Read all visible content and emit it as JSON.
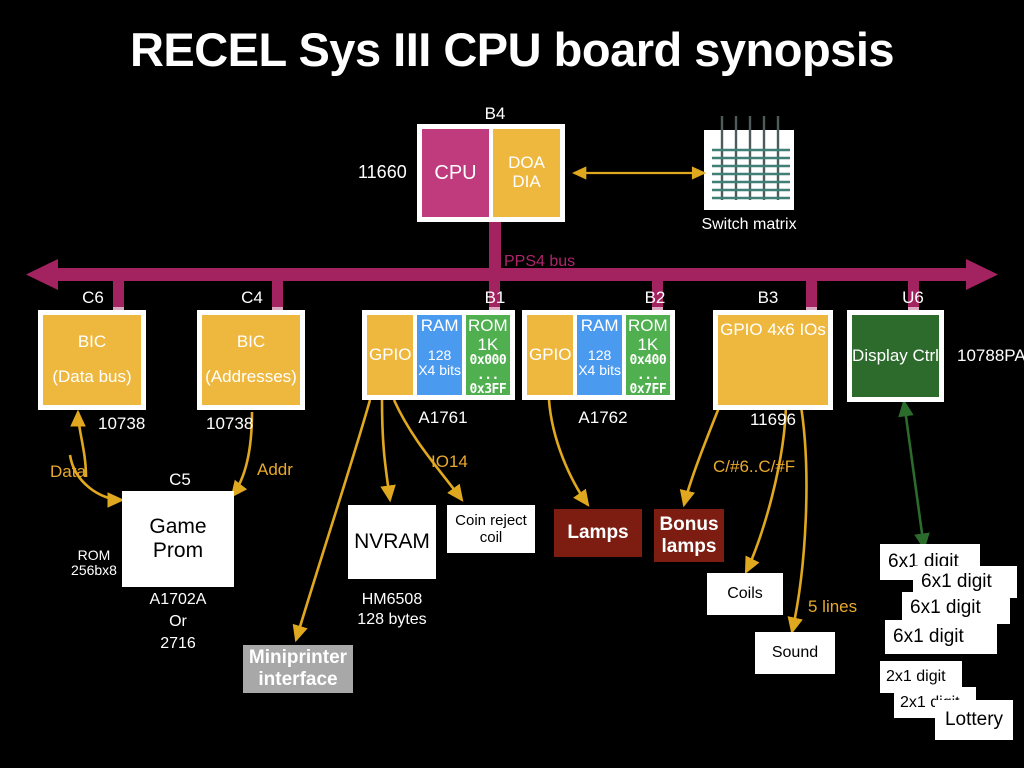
{
  "title": "RECEL Sys III CPU board synopsis",
  "bus": {
    "label": "PPS4 bus",
    "color": "#a32260"
  },
  "cpu_block": {
    "tag": "B4",
    "part": "11660",
    "cpu_label": "CPU",
    "doa_line1": "DOA",
    "doa_line2": "DIA"
  },
  "switch_matrix": {
    "caption": "Switch matrix"
  },
  "chips": [
    {
      "tag": "C6",
      "part": "10738",
      "cells": [
        {
          "name": "BIC",
          "sub": "(Data bus)"
        }
      ]
    },
    {
      "tag": "C4",
      "part": "10738",
      "cells": [
        {
          "name": "BIC",
          "sub": "(Addresses)"
        }
      ]
    },
    {
      "tag": "B1",
      "part": "A1761",
      "cells": [
        {
          "name": "GPIO"
        },
        {
          "name": "RAM",
          "l1": "128",
          "l2": "X4 bits"
        },
        {
          "name": "ROM",
          "l1": "1K",
          "m1": "0x000",
          "m2": "...",
          "m3": "0x3FF"
        }
      ]
    },
    {
      "tag": "B2",
      "part": "A1762",
      "cells": [
        {
          "name": "GPIO"
        },
        {
          "name": "RAM",
          "l1": "128",
          "l2": "X4 bits"
        },
        {
          "name": "ROM",
          "l1": "1K",
          "m1": "0x400",
          "m2": "...",
          "m3": "0x7FF"
        }
      ]
    },
    {
      "tag": "B3",
      "part": "11696",
      "cells": [
        {
          "name": "GPIO 4x6 IOs"
        }
      ]
    },
    {
      "tag": "U6",
      "part": "10788PA",
      "cells": [
        {
          "name": "Display Ctrl"
        }
      ]
    }
  ],
  "peripherals": {
    "game_prom": {
      "tag": "C5",
      "line1": "Game",
      "line2": "Prom",
      "note_left_1": "ROM",
      "note_left_2": "256bx8",
      "part_1": "A1702A",
      "part_2": "Or",
      "part_3": "2716"
    },
    "miniprinter": {
      "line1": "Miniprinter",
      "line2": "interface"
    },
    "nvram": {
      "name": "NVRAM",
      "part_1": "HM6508",
      "part_2": "128 bytes"
    },
    "coin_reject": {
      "line1": "Coin reject",
      "line2": "coil"
    },
    "lamps": {
      "name": "Lamps"
    },
    "bonus_lamps": {
      "line1": "Bonus",
      "line2": "lamps"
    },
    "coils": {
      "name": "Coils"
    },
    "sound": {
      "name": "Sound"
    },
    "displays": [
      {
        "label": "6x1 digit"
      },
      {
        "label": "6x1 digit"
      },
      {
        "label": "6x1 digit"
      },
      {
        "label": "6x1 digit"
      },
      {
        "label": "2x1 digit"
      },
      {
        "label": "2x1 digit"
      },
      {
        "label": "Lottery"
      }
    ]
  },
  "edge_labels": {
    "data": "Data",
    "addr": "Addr",
    "io14": "IO14",
    "c_range": "C/#6..C/#F",
    "five_lines": "5 lines"
  },
  "colors": {
    "bus": "#a32260",
    "cpu": "#c03a7e",
    "amber": "#eeb83f",
    "blue": "#4a9aef",
    "green": "#50b04f",
    "dark_green": "#2c6b2c",
    "red": "#7d1d11",
    "gray": "#a8a8a8",
    "gold_arrow": "#e0a81f",
    "white": "#ffffff",
    "background": "#000000"
  }
}
